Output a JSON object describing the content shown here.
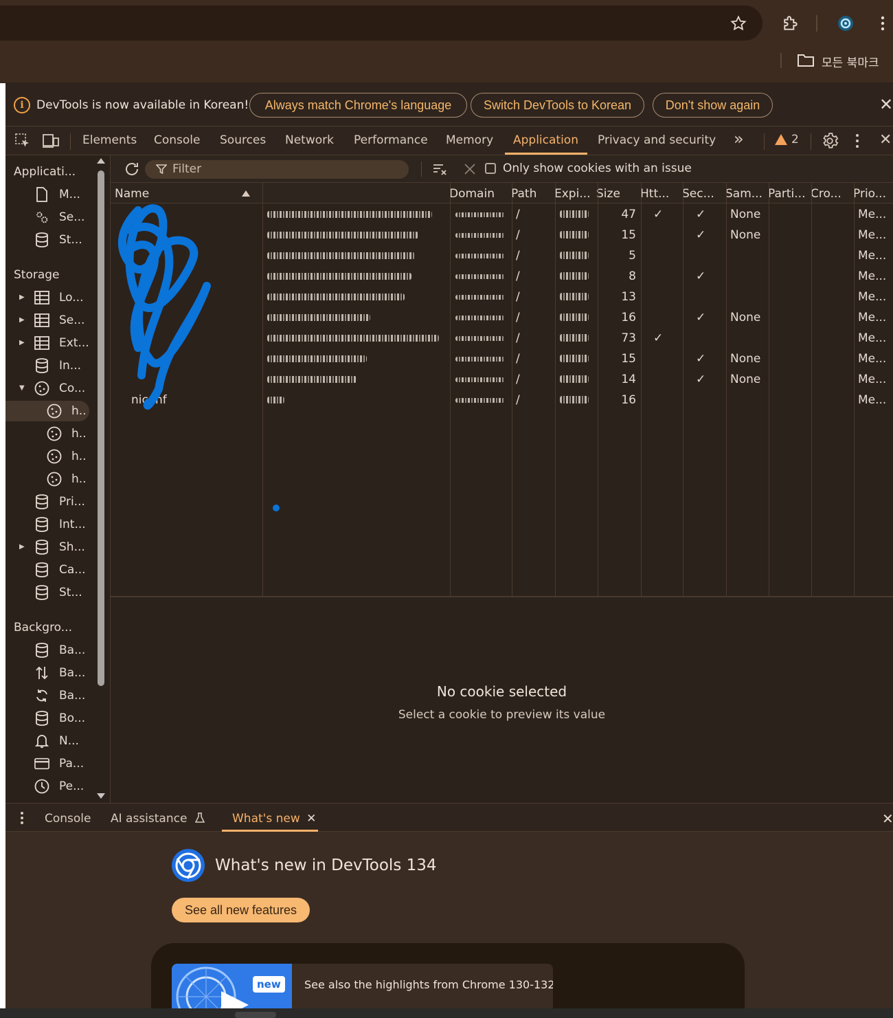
{
  "browser": {
    "bookmarks_label": "모든 북마크",
    "icons": [
      "star-icon",
      "extensions-icon",
      "profile-icon",
      "menu-icon",
      "folder-icon"
    ]
  },
  "infobar": {
    "message": "DevTools is now available in Korean!",
    "btn_match": "Always match Chrome's language",
    "btn_switch": "Switch DevTools to Korean",
    "btn_dont_show": "Don't show again",
    "close": "✕"
  },
  "tabs": {
    "elements": "Elements",
    "console": "Console",
    "sources": "Sources",
    "network": "Network",
    "performance": "Performance",
    "memory": "Memory",
    "application": "Application",
    "privacy": "Privacy and security",
    "more": "»",
    "warnings": "2",
    "close": "✕"
  },
  "sidebar": {
    "app_heading": "Applicati...",
    "app_items": [
      "M...",
      "Se...",
      "St..."
    ],
    "storage_heading": "Storage",
    "storage_items": [
      "Lo...",
      "Se...",
      "Ext...",
      "In...",
      "Co..."
    ],
    "cookie_hosts": [
      "h..",
      "h..",
      "h..",
      "h.."
    ],
    "storage_items2": [
      "Pri...",
      "Int...",
      "Sh...",
      "Ca...",
      "St..."
    ],
    "bg_heading": "Backgro...",
    "bg_items": [
      "Ba...",
      "Ba...",
      "Ba...",
      "Bo...",
      "N...",
      "Pa...",
      "Pe..."
    ]
  },
  "cookie_toolbar": {
    "filter_placeholder": "Filter",
    "only_issue": "Only show cookies with an issue"
  },
  "table": {
    "headers": {
      "name": "Name",
      "domain": "Domain",
      "path": "Path",
      "expires": "Expi...",
      "size": "Size",
      "http": "Htt...",
      "secure": "Sec...",
      "samesite": "Sam...",
      "partition": "Parti...",
      "cross": "Cro...",
      "priority": "Prio..."
    },
    "rows": [
      {
        "name": "",
        "path": "/",
        "size": "47",
        "http": "✓",
        "secure": "✓",
        "samesite": "None",
        "priority": "Me..."
      },
      {
        "name": "",
        "path": "/",
        "size": "15",
        "http": "",
        "secure": "✓",
        "samesite": "None",
        "priority": "Me..."
      },
      {
        "name": "",
        "path": "/",
        "size": "5",
        "http": "",
        "secure": "",
        "samesite": "",
        "priority": "Me..."
      },
      {
        "name": "",
        "path": "/",
        "size": "8",
        "http": "",
        "secure": "✓",
        "samesite": "",
        "priority": "Me..."
      },
      {
        "name": "",
        "path": "/",
        "size": "13",
        "http": "",
        "secure": "",
        "samesite": "",
        "priority": "Me..."
      },
      {
        "name": "",
        "path": "/",
        "size": "16",
        "http": "",
        "secure": "✓",
        "samesite": "None",
        "priority": "Me..."
      },
      {
        "name": "",
        "path": "/",
        "size": "73",
        "http": "✓",
        "secure": "",
        "samesite": "",
        "priority": "Me..."
      },
      {
        "name": "",
        "path": "/",
        "size": "15",
        "http": "",
        "secure": "✓",
        "samesite": "None",
        "priority": "Me..."
      },
      {
        "name": "",
        "path": "/",
        "size": "14",
        "http": "",
        "secure": "✓",
        "samesite": "None",
        "priority": "Me..."
      },
      {
        "name": "nic inf",
        "path": "/",
        "size": "16",
        "http": "",
        "secure": "",
        "samesite": "",
        "priority": "Me..."
      }
    ]
  },
  "preview": {
    "title": "No cookie selected",
    "subtitle": "Select a cookie to preview its value"
  },
  "drawer": {
    "console": "Console",
    "ai": "AI assistance",
    "whats_new": "What's new",
    "close": "✕"
  },
  "whats_new": {
    "title": "What's new in DevTools 134",
    "button": "See all new features",
    "badge": "new",
    "highlight": "See also the highlights from Chrome 130-132"
  },
  "colors": {
    "accent": "#f6b26b",
    "background": "#2b221c",
    "scribble": "#0a74d9"
  }
}
